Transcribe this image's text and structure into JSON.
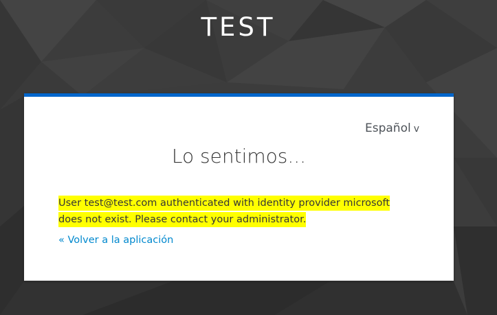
{
  "realm": {
    "title": "TEST"
  },
  "locale": {
    "selected": "Español",
    "chevron": "v"
  },
  "card": {
    "title": "Lo sentimos...",
    "message": "User test@test.com authenticated with identity provider microsoft does not exist. Please contact your administrator.",
    "back_link": "« Volver a la aplicación"
  },
  "colors": {
    "accent": "#0066cc",
    "link": "#0088ce",
    "highlight": "#ffff00",
    "background": "#3b3b3b"
  }
}
